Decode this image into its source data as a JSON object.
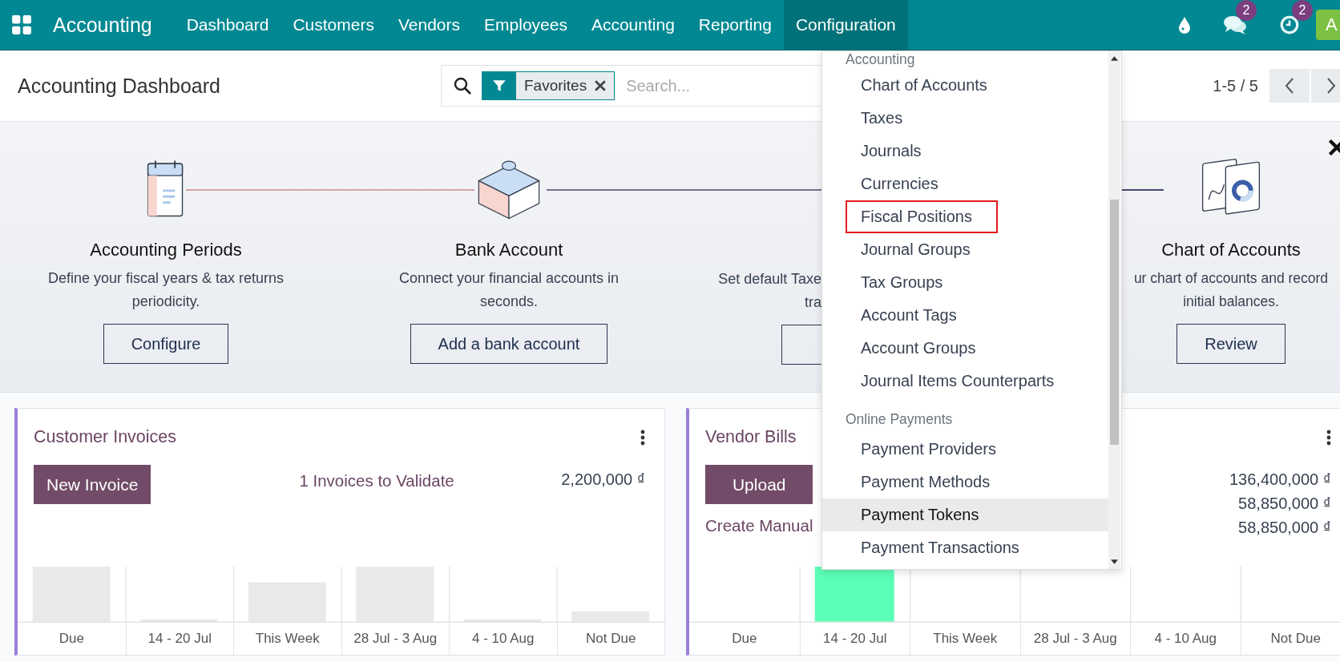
{
  "navbar": {
    "app_name": "Accounting",
    "menus": [
      {
        "label": "Dashboard",
        "selected": false
      },
      {
        "label": "Customers",
        "selected": false
      },
      {
        "label": "Vendors",
        "selected": false
      },
      {
        "label": "Employees",
        "selected": false
      },
      {
        "label": "Accounting",
        "selected": false
      },
      {
        "label": "Reporting",
        "selected": false
      },
      {
        "label": "Configuration",
        "selected": true
      }
    ],
    "systray": [
      {
        "kind": "drop"
      },
      {
        "kind": "chat",
        "badge": "2"
      },
      {
        "kind": "clock",
        "badge": "2"
      }
    ],
    "avatar": "A"
  },
  "control_panel": {
    "title": "Accounting Dashboard",
    "search": {
      "facet": "Favorites",
      "placeholder": "Search..."
    },
    "pager": "1-5 / 5"
  },
  "onboarding": {
    "steps": [
      {
        "kind": "full",
        "title": "Accounting Periods",
        "description": "Define your fiscal years & tax returns periodicity.",
        "button": "Configure"
      },
      {
        "kind": "full",
        "title": "Bank Account",
        "description": "Connect your financial accounts in seconds.",
        "button": "Add a bank account"
      },
      {
        "kind": "cut-right",
        "description": "Set default Taxe tra"
      },
      {
        "kind": "full",
        "title": "Chart of Accounts",
        "description": "ur chart of accounts and record initial balances.",
        "button": "Review"
      }
    ]
  },
  "dropdown": {
    "sections": [
      {
        "title": "Accounting",
        "items": [
          {
            "label": "Chart of Accounts",
            "selected": false,
            "outlined": false
          },
          {
            "label": "Taxes",
            "selected": false,
            "outlined": false
          },
          {
            "label": "Journals",
            "selected": false,
            "outlined": false
          },
          {
            "label": "Currencies",
            "selected": false,
            "outlined": false
          },
          {
            "label": "Fiscal Positions",
            "selected": false,
            "outlined": true
          },
          {
            "label": "Journal Groups",
            "selected": false,
            "outlined": false
          },
          {
            "label": "Tax Groups",
            "selected": false,
            "outlined": false
          },
          {
            "label": "Account Tags",
            "selected": false,
            "outlined": false
          },
          {
            "label": "Account Groups",
            "selected": false,
            "outlined": false
          },
          {
            "label": "Journal Items Counterparts",
            "selected": false,
            "outlined": false
          }
        ]
      },
      {
        "title": "Online Payments",
        "items": [
          {
            "label": "Payment Providers",
            "selected": false,
            "outlined": false
          },
          {
            "label": "Payment Methods",
            "selected": false,
            "outlined": false
          },
          {
            "label": "Payment Tokens",
            "selected": true,
            "outlined": false
          },
          {
            "label": "Payment Transactions",
            "selected": false,
            "outlined": false
          }
        ]
      }
    ]
  },
  "cards": [
    {
      "kind": "sale",
      "title": "Customer Invoices",
      "action": "New Invoice",
      "link": "1 Invoices to Validate",
      "amounts": [
        "2,200,000 ₫"
      ],
      "graph_labels": [
        "Due",
        "14 - 20 Jul",
        "This Week",
        "28 Jul - 3 Aug",
        "4 - 10 Aug",
        "Not Due"
      ]
    },
    {
      "kind": "purchase",
      "title": "Vendor Bills",
      "action": "Upload",
      "link": "Create Manual",
      "amounts": [
        "136,400,000 ₫",
        "58,850,000 ₫",
        "58,850,000 ₫"
      ],
      "graph_labels": [
        "Due",
        "14 - 20 Jul",
        "This Week",
        "28 Jul - 3 Aug",
        "4 - 10 Aug",
        "Not Due"
      ]
    }
  ]
}
